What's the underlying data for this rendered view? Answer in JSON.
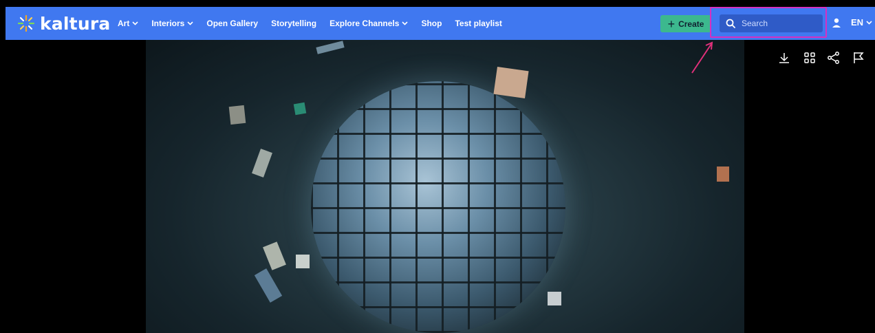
{
  "header": {
    "logo_text": "kaltura",
    "nav": [
      {
        "label": "Art",
        "has_dropdown": true
      },
      {
        "label": "Interiors",
        "has_dropdown": true
      },
      {
        "label": "Open Gallery",
        "has_dropdown": false
      },
      {
        "label": "Storytelling",
        "has_dropdown": false
      },
      {
        "label": "Explore Channels",
        "has_dropdown": true
      },
      {
        "label": "Shop",
        "has_dropdown": false
      },
      {
        "label": "Test playlist",
        "has_dropdown": false
      }
    ],
    "create_label": "Create",
    "search_placeholder": "Search",
    "language": "EN"
  },
  "player_toolbar": {
    "icons": [
      "download-icon",
      "grid-icon",
      "share-icon",
      "flag-icon"
    ]
  },
  "colors": {
    "header_bg": "#4078f0",
    "create_bg": "#3cb88e",
    "highlight": "#d72fc0"
  }
}
